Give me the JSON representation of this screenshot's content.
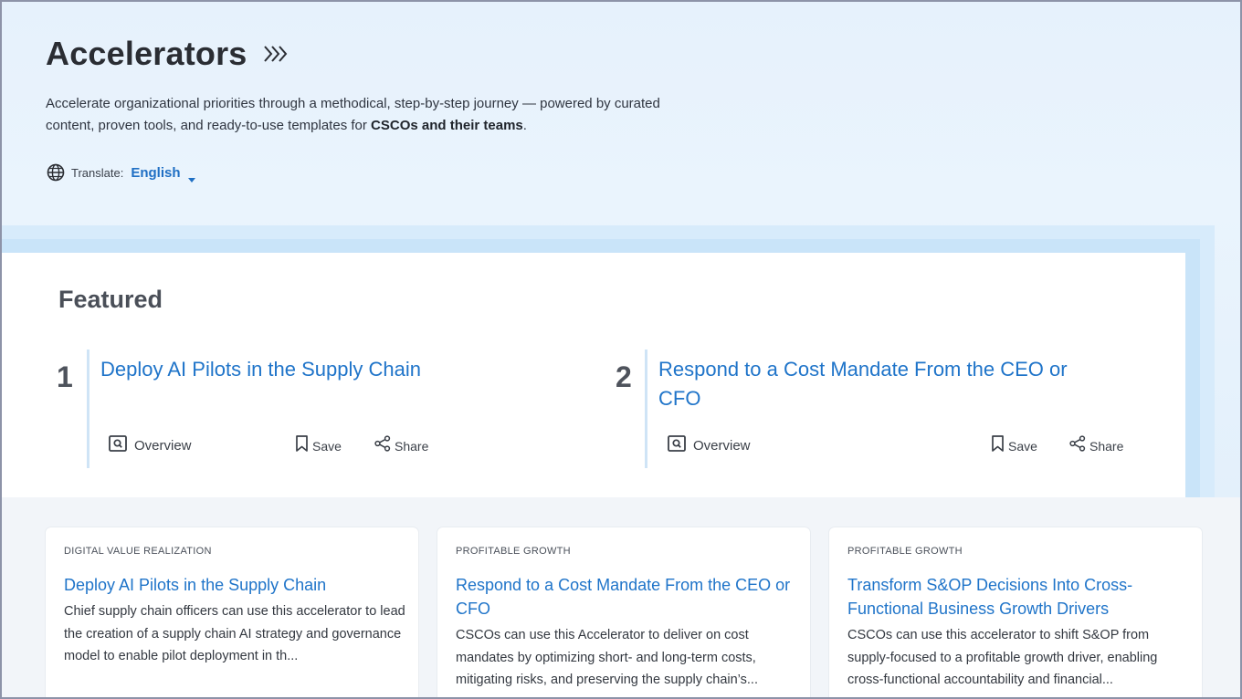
{
  "header": {
    "title": "Accelerators",
    "description_prefix": "Accelerate organizational priorities through a methodical, step-by-step journey — powered by curated content, proven tools, and ready-to-use templates for ",
    "description_bold": "CSCOs and their teams",
    "description_suffix": ".",
    "translate_label": "Translate:",
    "language": "English"
  },
  "featured": {
    "heading": "Featured",
    "items": [
      {
        "number": "1",
        "title": "Deploy AI Pilots in the Supply Chain",
        "overview_label": "Overview",
        "save_label": "Save",
        "share_label": "Share"
      },
      {
        "number": "2",
        "title": "Respond to a Cost Mandate From the CEO or CFO",
        "overview_label": "Overview",
        "save_label": "Save",
        "share_label": "Share"
      }
    ]
  },
  "cards": [
    {
      "category": "DIGITAL VALUE REALIZATION",
      "title": "Deploy AI Pilots in the Supply Chain",
      "description": "Chief supply chain officers can use this accelerator to lead the creation of a supply chain AI strategy and governance model to enable pilot deployment in th..."
    },
    {
      "category": "PROFITABLE GROWTH",
      "title": "Respond to a Cost Mandate From the CEO or CFO",
      "description": "CSCOs can use this Accelerator to deliver on cost mandates by optimizing short- and long-term costs, mitigating risks, and preserving the supply chain’s..."
    },
    {
      "category": "PROFITABLE GROWTH",
      "title": "Transform S&OP Decisions Into Cross-Functional Business Growth Drivers",
      "description": "CSCOs can use this accelerator to shift S&OP from supply-focused to a profitable growth driver, enabling cross-functional accountability and financial..."
    }
  ],
  "colors": {
    "link": "#1f74c9",
    "language_accent": "#1f6fc4"
  },
  "icons": [
    "chevrons-right-icon",
    "globe-icon",
    "caret-down-icon",
    "overview-icon",
    "bookmark-icon",
    "share-icon"
  ]
}
